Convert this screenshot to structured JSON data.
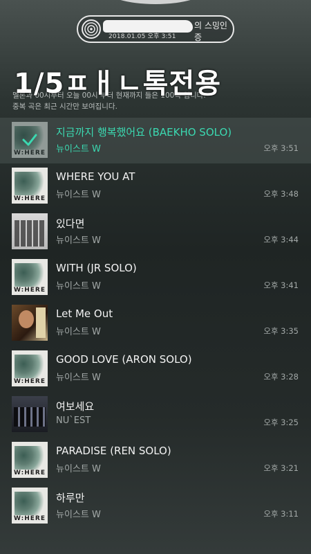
{
  "badge": {
    "label": "의 스밍인증",
    "date": "2018.01.05 오후 3:51"
  },
  "watermark": "1/5ㅍㅐㄴ톡전용",
  "notice": {
    "line1": "멜론과 00시부터 오늘 00시 부터 현재까지 들은 100곡 입니다.",
    "line2": "중복 곡은 최근 시간만 보여집니다."
  },
  "songs": [
    {
      "title": "지금까지 행복했어요 (BAEKHO SOLO)",
      "artist": "뉴이스트 W",
      "time": "오후 3:51",
      "selected": true,
      "cover": "where"
    },
    {
      "title": "WHERE YOU AT",
      "artist": "뉴이스트 W",
      "time": "오후 3:48",
      "cover": "where"
    },
    {
      "title": "있다면",
      "artist": "뉴이스트 W",
      "time": "오후 3:44",
      "cover": "group"
    },
    {
      "title": "WITH (JR SOLO)",
      "artist": "뉴이스트 W",
      "time": "오후 3:41",
      "cover": "where"
    },
    {
      "title": "Let Me Out",
      "artist": "뉴이스트 W",
      "time": "오후 3:35",
      "cover": "solo"
    },
    {
      "title": "GOOD LOVE (ARON SOLO)",
      "artist": "뉴이스트 W",
      "time": "오후 3:28",
      "cover": "where"
    },
    {
      "title": "여보세요",
      "artist": "NU`EST",
      "time": "오후 3:25",
      "cover": "dark"
    },
    {
      "title": "PARADISE (REN SOLO)",
      "artist": "뉴이스트 W",
      "time": "오후 3:21",
      "cover": "where"
    },
    {
      "title": "하루만",
      "artist": "뉴이스트 W",
      "time": "오후 3:11",
      "cover": "where"
    }
  ],
  "cover_text": "W:HERE",
  "colors": {
    "accent": "#3bd9b1",
    "background": "#252b2a"
  },
  "icons": {
    "badge": "vinyl-disc-icon",
    "selected": "checkmark-icon"
  }
}
